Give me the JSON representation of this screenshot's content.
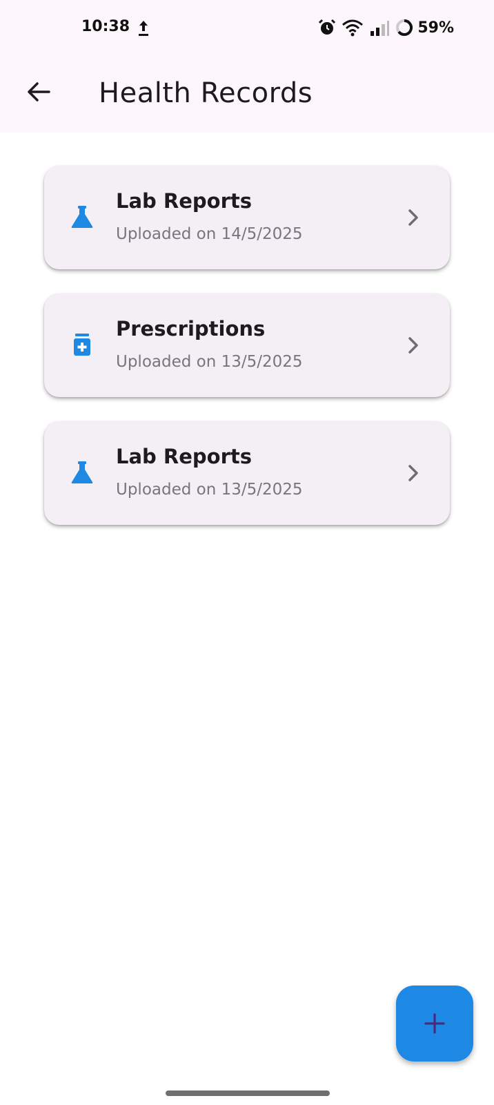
{
  "status_bar": {
    "time": "10:38",
    "battery": "59%",
    "icons": [
      "upload-icon",
      "alarm-icon",
      "wifi-icon",
      "signal-icon",
      "battery-icon"
    ]
  },
  "app_bar": {
    "title": "Health Records",
    "back_icon": "arrow-back-icon"
  },
  "records": [
    {
      "title": "Lab Reports",
      "subtitle": "Uploaded on 14/5/2025",
      "icon": "flask-icon"
    },
    {
      "title": "Prescriptions",
      "subtitle": "Uploaded on 13/5/2025",
      "icon": "medicine-bottle-icon"
    },
    {
      "title": "Lab Reports",
      "subtitle": "Uploaded on 13/5/2025",
      "icon": "flask-icon"
    }
  ],
  "fab": {
    "icon": "plus-icon"
  },
  "colors": {
    "accent": "#1e88e5",
    "card_bg": "#f4eff4",
    "app_bar_bg": "#fdf7fc",
    "subtitle": "#79747e",
    "fab_icon": "#4a2a7a"
  }
}
